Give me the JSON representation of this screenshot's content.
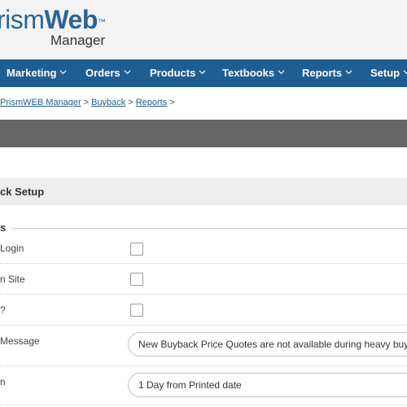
{
  "brand": {
    "logo_light": "rism",
    "logo_bold": "Web",
    "logo_tm": "™",
    "logo_sub": "Manager",
    "color": "#2a6496"
  },
  "nav": {
    "items": [
      {
        "label": "Marketing"
      },
      {
        "label": "Orders"
      },
      {
        "label": "Products"
      },
      {
        "label": "Textbooks"
      },
      {
        "label": "Reports"
      },
      {
        "label": "Setup"
      }
    ],
    "background": "#1f5e93"
  },
  "breadcrumb": {
    "items": [
      "PrismWEB Manager",
      "Buyback",
      "Reports"
    ],
    "separator": ">"
  },
  "section": {
    "title": "ck Setup",
    "group_legend": "s"
  },
  "fields": [
    {
      "label": "Login",
      "type": "checkbox",
      "checked": false
    },
    {
      "label": "n Site",
      "type": "checkbox",
      "checked": false
    },
    {
      "label": "?",
      "type": "checkbox",
      "checked": false
    },
    {
      "label": "Message",
      "type": "text",
      "value": "New Buyback Price Quotes are not available during heavy buyb"
    },
    {
      "label": "n",
      "type": "text",
      "value": "1 Day from Printed date"
    }
  ]
}
